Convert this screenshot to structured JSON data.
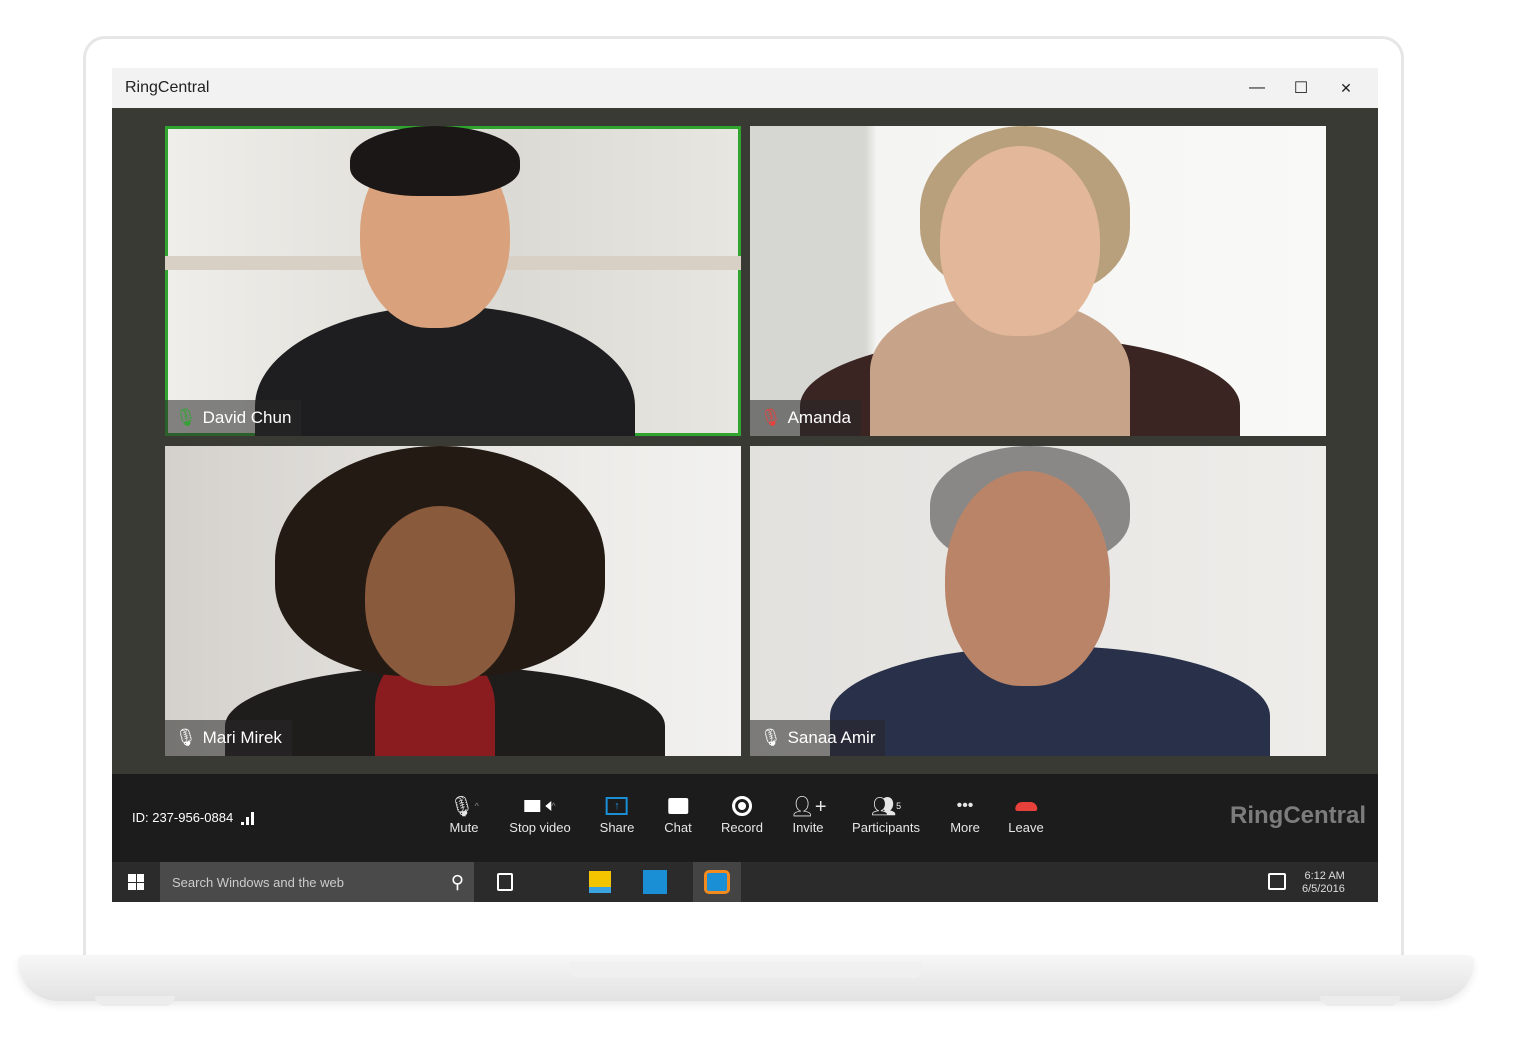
{
  "window": {
    "title": "RingCentral",
    "minimize": "—",
    "maximize": "☐",
    "close": "✕"
  },
  "participants": [
    {
      "name": "David Chun",
      "mic": "on",
      "active": true
    },
    {
      "name": "Amanda",
      "mic": "muted",
      "active": false
    },
    {
      "name": "Mari Mirek",
      "mic": "on",
      "active": false
    },
    {
      "name": "Sanaa Amir",
      "mic": "on",
      "active": false
    }
  ],
  "toolbar": {
    "meeting_id": "ID: 237-956-0884",
    "buttons": [
      {
        "label": "Mute",
        "icon": "microphone-icon"
      },
      {
        "label": "Stop video",
        "icon": "video-camera-icon"
      },
      {
        "label": "Share",
        "icon": "share-screen-icon"
      },
      {
        "label": "Chat",
        "icon": "chat-icon"
      },
      {
        "label": "Record",
        "icon": "record-icon"
      },
      {
        "label": "Invite",
        "icon": "add-user-icon"
      },
      {
        "label": "Participants",
        "icon": "participants-icon",
        "badge": "5"
      },
      {
        "label": "More",
        "icon": "more-icon"
      },
      {
        "label": "Leave",
        "icon": "hang-up-icon"
      }
    ],
    "brand": "RingCentral",
    "accent": "#2fa52f",
    "share_color": "#1a8fd6",
    "leave_color": "#e8403a"
  },
  "taskbar": {
    "search_placeholder": "Search Windows and the web",
    "time": "6:12 AM",
    "date": "6/5/2016"
  }
}
